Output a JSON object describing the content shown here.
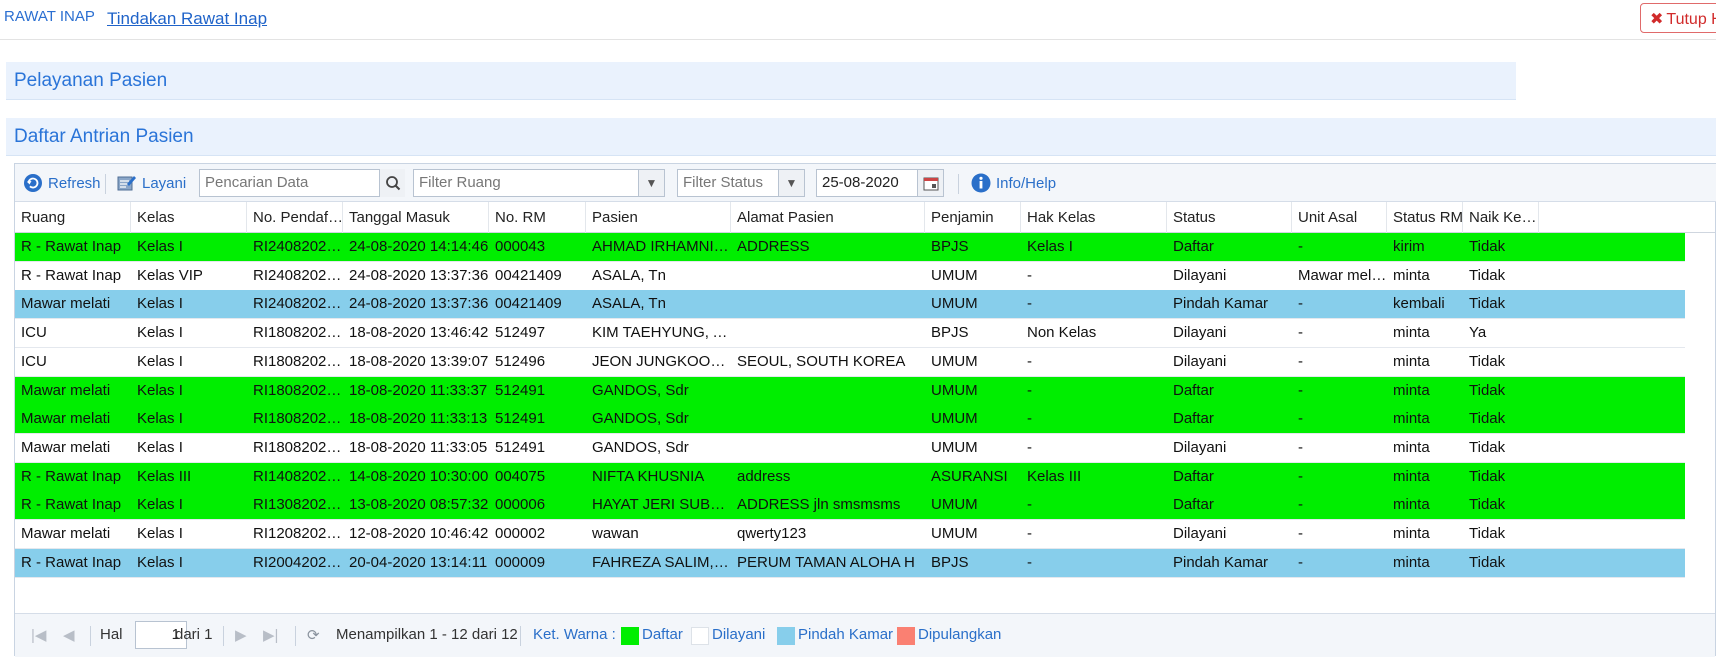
{
  "nav": {
    "breadcrumb_root": "RAWAT INAP",
    "breadcrumb_current": "Tindakan Rawat Inap",
    "close_label": "Tutup H"
  },
  "panels": {
    "service_title": "Pelayanan Pasien",
    "queue_title": "Daftar Antrian Pasien"
  },
  "toolbar": {
    "refresh_label": "Refresh",
    "serve_label": "Layani",
    "search_placeholder": "Pencarian Data",
    "room_filter_placeholder": "Filter Ruang",
    "status_filter_placeholder": "Filter Status",
    "date_value": "25-08-2020",
    "help_label": "Info/Help"
  },
  "columns": [
    "Ruang",
    "Kelas",
    "No. Pendaf…",
    "Tanggal Masuk",
    "No. RM",
    "Pasien",
    "Alamat Pasien",
    "Penjamin",
    "Hak Kelas",
    "Status",
    "Unit Asal",
    "Status RM",
    "Naik Ke…"
  ],
  "rows": [
    {
      "color": "#00ee00",
      "cells": [
        "R - Rawat Inap",
        "Kelas I",
        "RI2408202…",
        "24-08-2020 14:14:46",
        "000043",
        "AHMAD IRHAMNI, …",
        "ADDRESS",
        "BPJS",
        "Kelas I",
        "Daftar",
        "-",
        "kirim",
        "Tidak"
      ]
    },
    {
      "color": "#ffffff",
      "cells": [
        "R - Rawat Inap",
        "Kelas VIP",
        "RI2408202…",
        "24-08-2020 13:37:36",
        "00421409",
        "ASALA, Tn",
        "",
        "UMUM",
        "-",
        "Dilayani",
        "Mawar melati",
        "minta",
        "Tidak"
      ]
    },
    {
      "color": "#87ceeb",
      "cells": [
        "Mawar melati",
        "Kelas I",
        "RI2408202…",
        "24-08-2020 13:37:36",
        "00421409",
        "ASALA, Tn",
        "",
        "UMUM",
        "-",
        "Pindah Kamar",
        "-",
        "kembali",
        "Tidak"
      ]
    },
    {
      "color": "#ffffff",
      "cells": [
        "ICU",
        "Kelas I",
        "RI1808202…",
        "18-08-2020 13:46:42",
        "512497",
        "KIM TAEHYUNG, A…",
        "",
        "BPJS",
        "Non Kelas",
        "Dilayani",
        "-",
        "minta",
        "Ya"
      ]
    },
    {
      "color": "#ffffff",
      "cells": [
        "ICU",
        "Kelas I",
        "RI1808202…",
        "18-08-2020 13:39:07",
        "512496",
        "JEON JUNGKOOK…",
        "SEOUL, SOUTH KOREA",
        "UMUM",
        "-",
        "Dilayani",
        "-",
        "minta",
        "Tidak"
      ]
    },
    {
      "color": "#00ee00",
      "cells": [
        "Mawar melati",
        "Kelas I",
        "RI1808202…",
        "18-08-2020 11:33:37",
        "512491",
        "GANDOS, Sdr",
        "",
        "UMUM",
        "-",
        "Daftar",
        "-",
        "minta",
        "Tidak"
      ]
    },
    {
      "color": "#00ee00",
      "cells": [
        "Mawar melati",
        "Kelas I",
        "RI1808202…",
        "18-08-2020 11:33:13",
        "512491",
        "GANDOS, Sdr",
        "",
        "UMUM",
        "-",
        "Daftar",
        "-",
        "minta",
        "Tidak"
      ]
    },
    {
      "color": "#ffffff",
      "cells": [
        "Mawar melati",
        "Kelas I",
        "RI1808202…",
        "18-08-2020 11:33:05",
        "512491",
        "GANDOS, Sdr",
        "",
        "UMUM",
        "-",
        "Dilayani",
        "-",
        "minta",
        "Tidak"
      ]
    },
    {
      "color": "#00ee00",
      "cells": [
        "R - Rawat Inap",
        "Kelas III",
        "RI1408202…",
        "14-08-2020 10:30:00",
        "004075",
        "NIFTA KHUSNIA",
        "address",
        "ASURANSI",
        "Kelas III",
        "Daftar",
        "-",
        "minta",
        "Tidak"
      ]
    },
    {
      "color": "#00ee00",
      "cells": [
        "R - Rawat Inap",
        "Kelas I",
        "RI1308202…",
        "13-08-2020 08:57:32",
        "000006",
        "HAYAT JERI SUBA…",
        "ADDRESS jln smsmsms",
        "UMUM",
        "-",
        "Daftar",
        "-",
        "minta",
        "Tidak"
      ]
    },
    {
      "color": "#ffffff",
      "cells": [
        "Mawar melati",
        "Kelas I",
        "RI1208202…",
        "12-08-2020 10:46:42",
        "000002",
        "wawan",
        "qwerty123",
        "UMUM",
        "-",
        "Dilayani",
        "-",
        "minta",
        "Tidak"
      ]
    },
    {
      "color": "#87ceeb",
      "cells": [
        "R - Rawat Inap",
        "Kelas I",
        "RI2004202…",
        "20-04-2020 13:14:11",
        "000009",
        "FAHREZA SALIM, T…",
        "PERUM TAMAN ALOHA H",
        "BPJS",
        "-",
        "Pindah Kamar",
        "-",
        "minta",
        "Tidak"
      ]
    }
  ],
  "pager": {
    "page_label": "Hal",
    "page_value": "1",
    "of_label": "dari 1",
    "display_info": "Menampilkan 1 - 12 dari 12",
    "legend_title": "Ket. Warna :",
    "legend": [
      {
        "label": "Daftar",
        "color": "#00ee00"
      },
      {
        "label": "Dilayani",
        "color": "#ffffff"
      },
      {
        "label": "Pindah Kamar",
        "color": "#87ceeb"
      },
      {
        "label": "Dipulangkan",
        "color": "#fa8072"
      }
    ]
  }
}
